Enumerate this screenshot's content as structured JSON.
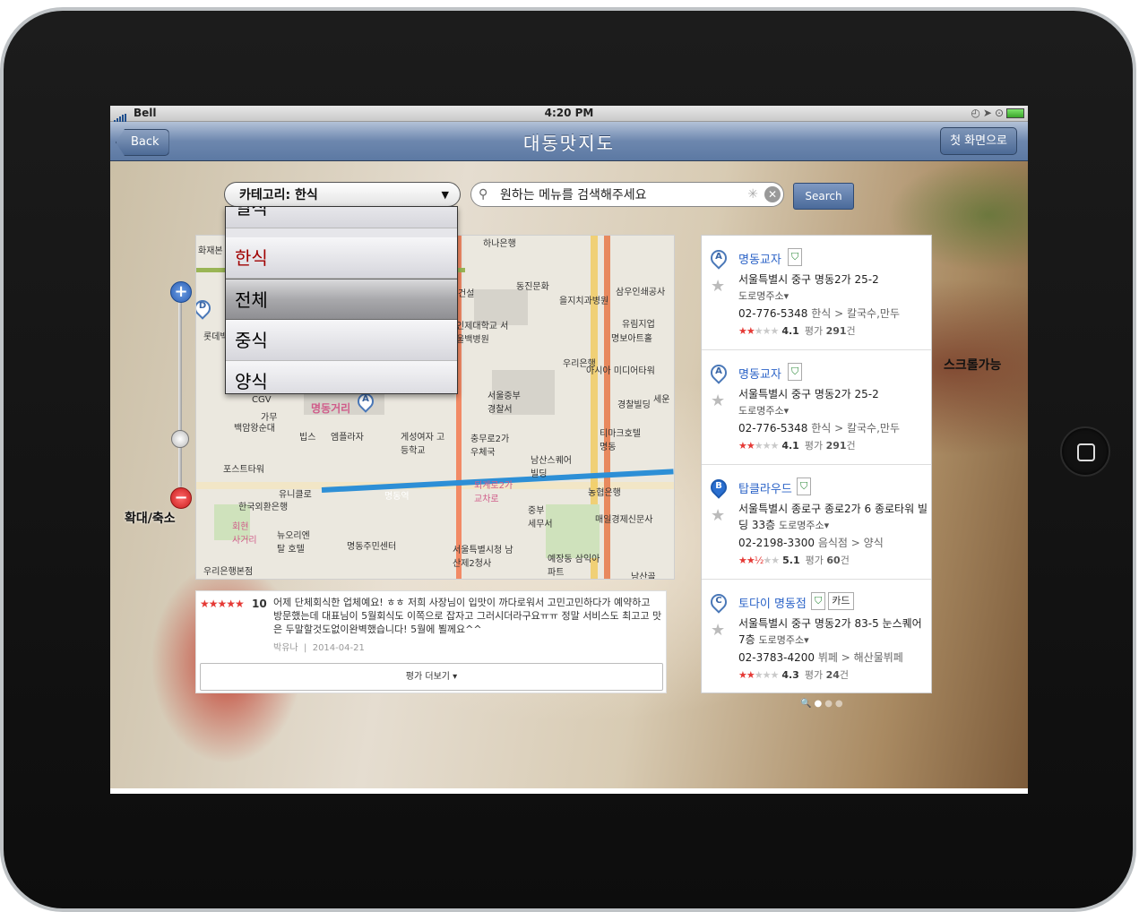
{
  "status_bar": {
    "carrier": "Bell",
    "time": "4:20 PM"
  },
  "nav": {
    "back_label": "Back",
    "title": "대동맛지도",
    "home_label": "첫 화면으로"
  },
  "category": {
    "label": "카테고리: 한식",
    "arrow": "▼"
  },
  "search": {
    "placeholder": "원하는 메뉴를 검색해주세요",
    "button_label": "Search"
  },
  "picker": {
    "options": [
      "일식",
      "한식",
      "전체",
      "중식",
      "양식"
    ]
  },
  "map": {
    "labels": [
      "하나은행",
      "동진문화",
      "을지치과병원",
      "삼우인쇄공사",
      "유림지업",
      "명보아트홀",
      "우리은행",
      "아시아 미디어타워",
      "경찰빌딩",
      "세운",
      "서울중부 경찰서",
      "충무로2가 우체국",
      "게성여자 고등학교",
      "티마크호텔 명동",
      "남산스퀘어 빌딩",
      "중부 세무서",
      "매일경제신문사",
      "예장동 삼익아파트",
      "서울특별시청 남산제2청사",
      "명동주민센터",
      "뉴오리엔탈 호텔",
      "유니클로",
      "한국외환은행",
      "농협은행",
      "퇴계로2가 교차로",
      "명동역",
      "엠플라자",
      "빕스",
      "가무",
      "CGV",
      "백암왕순대",
      "포스트타워",
      "롯데백",
      "화재본",
      "우리은행본점",
      "회현 사거리",
      "남산골",
      "인제대학교 서울백병원",
      "건설",
      "명동거리"
    ],
    "markers": [
      "A",
      "D"
    ]
  },
  "zoom": {
    "label": "확대/축소"
  },
  "scroll_label": "스크롤가능",
  "review": {
    "stars": "★★★★★",
    "score": "10",
    "text": "어제 단체회식한 업체예요! ㅎㅎ 저희 사장님이 입맛이 까다로워서 고민고민하다가 예약하고 방문했는데 대표님이 5월회식도 이쪽으로 잡자고 그러시더라구요ㅠㅠ 정말 서비스도 최고고 맛은 두말할것도없이완벽했습니다! 5월에 뵐께요^^",
    "author": "박유나",
    "date": "2014-04-21",
    "more_label": "평가 더보기 ▾"
  },
  "results": [
    {
      "marker": "A",
      "name": "명동교자",
      "badges": [
        "⛉"
      ],
      "address": "서울특별시 중구 명동2가 25-2",
      "ref": "도로명주소▾",
      "phone": "02-776-5348",
      "category": "한식 > 칼국수,만두",
      "stars_on": "★★",
      "stars_off": "★★★",
      "score": "4.1",
      "review_prefix": "평가",
      "review_count": "291",
      "review_suffix": "건"
    },
    {
      "marker": "A",
      "name": "명동교자",
      "badges": [
        "⛉"
      ],
      "address": "서울특별시 중구 명동2가 25-2",
      "ref": "도로명주소▾",
      "phone": "02-776-5348",
      "category": "한식 > 칼국수,만두",
      "stars_on": "★★",
      "stars_off": "★★★",
      "score": "4.1",
      "review_prefix": "평가",
      "review_count": "291",
      "review_suffix": "건"
    },
    {
      "marker": "B",
      "name": "탑클라우드",
      "badges": [
        "⛉"
      ],
      "address": "서울특별시 종로구 종로2가 6 종로타워 빌딩 33층",
      "ref": "도로명주소▾",
      "phone": "02-2198-3300",
      "category": "음식점 > 양식",
      "stars_on": "★★½",
      "stars_off": "★★",
      "score": "5.1",
      "review_prefix": "평가",
      "review_count": "60",
      "review_suffix": "건"
    },
    {
      "marker": "C",
      "name": "토다이 명동점",
      "badges": [
        "⛉",
        "카드"
      ],
      "address": "서울특별시 중구 명동2가 83-5 눈스퀘어 7층",
      "ref": "도로명주소▾",
      "phone": "02-3783-4200",
      "category": "뷔페 > 해산물뷔페",
      "stars_on": "★★",
      "stars_off": "★★★",
      "score": "4.3",
      "review_prefix": "평가",
      "review_count": "24",
      "review_suffix": "건"
    }
  ],
  "page_dots": {
    "search": "🔍"
  }
}
